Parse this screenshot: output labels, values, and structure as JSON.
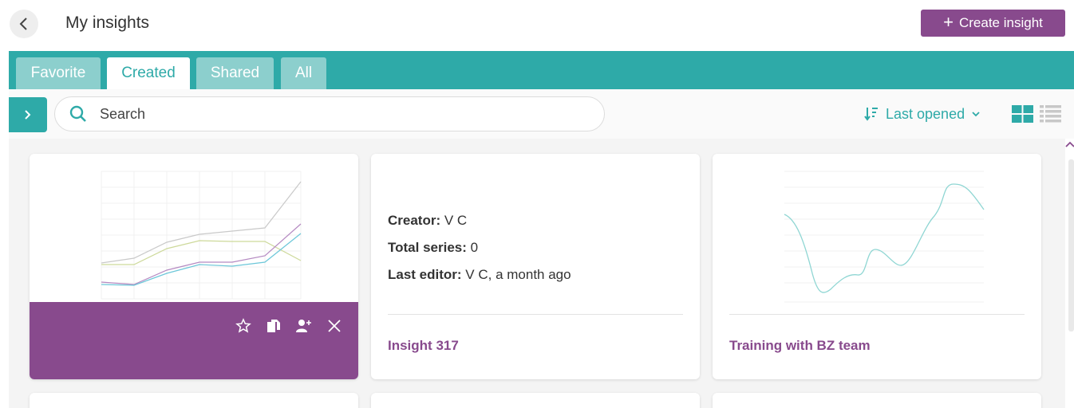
{
  "header": {
    "title": "My insights",
    "create_label": "Create insight"
  },
  "tabs": [
    {
      "label": "Favorite",
      "active": false
    },
    {
      "label": "Created",
      "active": true
    },
    {
      "label": "Shared",
      "active": false
    },
    {
      "label": "All",
      "active": false
    }
  ],
  "toolbar": {
    "search_placeholder": "Search",
    "sort_label": "Last opened"
  },
  "cards": [
    {
      "name": "",
      "preview": "multi-line-chart",
      "hovered": true,
      "actions": [
        "star-icon",
        "copy-icon",
        "share-user-icon",
        "close-icon"
      ]
    },
    {
      "name": "Insight 317",
      "creator_label": "Creator:",
      "creator": "V C",
      "series_label": "Total series:",
      "series": "0",
      "editor_label": "Last editor:",
      "editor": "V C, a month ago"
    },
    {
      "name": "Training with BZ team",
      "preview": "single-line-chart"
    }
  ],
  "colors": {
    "teal": "#2eaaa8",
    "purple": "#884a8d",
    "tab_inactive": "#8ccfcd"
  }
}
